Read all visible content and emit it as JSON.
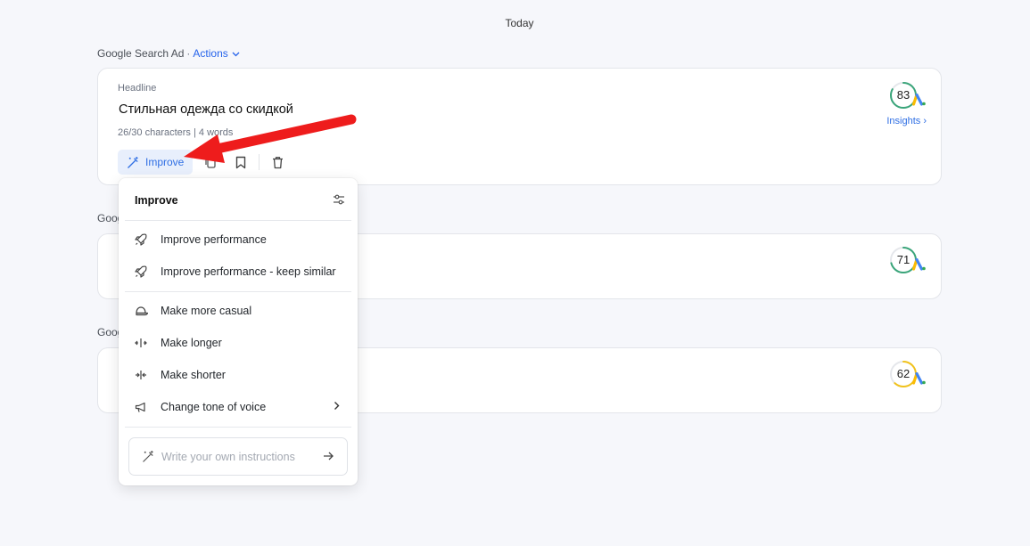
{
  "date_header": "Today",
  "section1": {
    "label": "Google Search Ad",
    "dot": "·",
    "actions": "Actions"
  },
  "card1": {
    "field_label": "Headline",
    "headline": "Стильная одежда со скидкой",
    "counts": "26/30 characters | 4 words",
    "improve_label": "Improve",
    "score": 83,
    "score_color": "#3aa57a",
    "insights": "Insights ›"
  },
  "section2": {
    "label": "Goog"
  },
  "card2": {
    "score": 71,
    "score_color": "#3aa57a"
  },
  "section3": {
    "label": "Goog"
  },
  "card3": {
    "score": 62,
    "score_color": "#f1c21b"
  },
  "menu": {
    "title": "Improve",
    "items": [
      {
        "label": "Improve performance",
        "icon": "rocket-icon"
      },
      {
        "label": "Improve performance - keep similar",
        "icon": "rocket-icon"
      },
      {
        "label": "Make more casual",
        "icon": "cap-icon"
      },
      {
        "label": "Make longer",
        "icon": "expand-icon"
      },
      {
        "label": "Make shorter",
        "icon": "shrink-icon"
      },
      {
        "label": "Change tone of voice",
        "icon": "megaphone-icon"
      }
    ],
    "instructions_placeholder": "Write your own instructions"
  },
  "colors": {
    "accent": "#2f6fe4",
    "annotation_arrow": "#ee1c1c"
  }
}
